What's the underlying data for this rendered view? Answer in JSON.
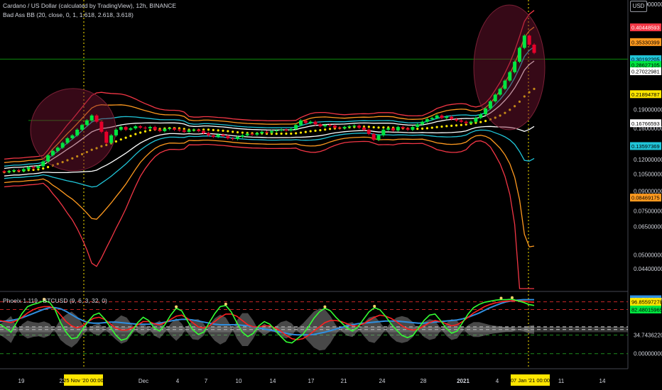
{
  "header": {
    "title": "Cardano / US Dollar (calculated by TradingView), 12h, BINANCE",
    "indicator1": "Bad Ass BB (20, close, 0, 1, 1.618, 2.618, 3.618)",
    "indicator2": "Phoeix 1.119 - BTCUSD (9, 6, 3, 32, 0)",
    "currency": "USD"
  },
  "colors": {
    "background": "#000000",
    "up_candle": "#00e640",
    "down_candle": "#e6002a",
    "green_line": "#0b8a0b",
    "band_red": "#f23645",
    "band_orange": "#ff9a1f",
    "band_cyan": "#20c5d8",
    "band_white": "#ffffff",
    "basis_yellow": "#ffe600",
    "osc_green": "#33ff33",
    "osc_red": "#ff2020",
    "osc_blue": "#2f8fe0"
  },
  "chart_data": [
    {
      "type": "candlestick",
      "title": "Cardano / US Dollar (calculated by TradingView), 12h, BINANCE",
      "scale": "log",
      "ylim": [
        0.036,
        0.52
      ],
      "x_ticks": [
        "19",
        "23",
        "Dec",
        "4",
        "7",
        "10",
        "14",
        "17",
        "21",
        "24",
        "28",
        "2021",
        "4",
        "11",
        "14"
      ],
      "x_highlights": [
        "25 Nov '20  00:00",
        "07 Jan '21  00:00"
      ],
      "y_ticks": [
        0.5,
        0.19,
        0.16,
        0.12,
        0.105,
        0.09,
        0.075,
        0.065,
        0.05,
        0.044
      ],
      "price_labels": [
        {
          "text": "0.40448593",
          "color": "#f23645"
        },
        {
          "text": "0.35330399",
          "color": "#ff9a1f"
        },
        {
          "text": "0.30254697",
          "color": "#e6002a"
        },
        {
          "text": "01:00:56",
          "color": "#e6002a"
        },
        {
          "text": "0.30192205",
          "color": "#20c5d8"
        },
        {
          "text": "0.28627105",
          "color": "#00e640"
        },
        {
          "text": "0.27022981",
          "color": "#ffffff"
        },
        {
          "text": "0.21894787",
          "color": "#ffe600"
        },
        {
          "text": "0.16766593",
          "color": "#ffffff"
        },
        {
          "text": "0.13597369",
          "color": "#20c5d8"
        },
        {
          "text": "0.08469175",
          "color": "#ff9a1f"
        }
      ],
      "series": [
        {
          "name": "close",
          "start": 0.108,
          "values": [
            0.107,
            0.108,
            0.109,
            0.108,
            0.11,
            0.112,
            0.111,
            0.113,
            0.118,
            0.125,
            0.13,
            0.134,
            0.14,
            0.146,
            0.15,
            0.158,
            0.165,
            0.172,
            0.18,
            0.17,
            0.155,
            0.14,
            0.15,
            0.158,
            0.162,
            0.158,
            0.16,
            0.163,
            0.161,
            0.16,
            0.162,
            0.158,
            0.156,
            0.159,
            0.16,
            0.158,
            0.157,
            0.155,
            0.157,
            0.158,
            0.156,
            0.153,
            0.15,
            0.148,
            0.151,
            0.149,
            0.146,
            0.145,
            0.148,
            0.15,
            0.152,
            0.151,
            0.153,
            0.155,
            0.154,
            0.156,
            0.157,
            0.158,
            0.157,
            0.159,
            0.165,
            0.172,
            0.168,
            0.17,
            0.166,
            0.163,
            0.165,
            0.164,
            0.161,
            0.16,
            0.162,
            0.163,
            0.164,
            0.161,
            0.158,
            0.152,
            0.144,
            0.15,
            0.158,
            0.16,
            0.157,
            0.162,
            0.16,
            0.158,
            0.162,
            0.166,
            0.17,
            0.174,
            0.176,
            0.18,
            0.176,
            0.178,
            0.174,
            0.172,
            0.17,
            0.168,
            0.17,
            0.176,
            0.182,
            0.192,
            0.205,
            0.218,
            0.23,
            0.248,
            0.268,
            0.295,
            0.335,
            0.375,
            0.345,
            0.32
          ]
        }
      ]
    },
    {
      "type": "line",
      "title": "Phoeix 1.119 - BTCUSD (9, 6, 3, 32, 0)",
      "ylim": [
        -15,
        115
      ],
      "y_ticks": [
        0.0,
        34.74362206,
        82.48015965,
        96.85597278,
        101.71204067
      ],
      "value_labels": [
        {
          "text": "101.71204067",
          "color": "#2f8fe0"
        },
        {
          "text": "96.85597278",
          "color": "#ffe600"
        },
        {
          "text": "82.48015965",
          "color": "#00e640"
        },
        {
          "text": "34.74362206",
          "color": "#000000"
        },
        {
          "text": "0.00000000",
          "color": "#000000"
        }
      ],
      "series": [
        {
          "name": "green",
          "values": [
            55,
            48,
            40,
            58,
            75,
            88,
            92,
            95,
            99,
            96,
            82,
            58,
            40,
            28,
            30,
            45,
            60,
            72,
            76,
            65,
            50,
            35,
            25,
            28,
            42,
            58,
            68,
            62,
            48,
            42,
            55,
            72,
            85,
            80,
            62,
            45,
            36,
            40,
            58,
            75,
            88,
            90,
            78,
            58,
            40,
            32,
            38,
            52,
            60,
            55,
            44,
            32,
            22,
            20,
            28,
            36,
            50,
            66,
            78,
            85,
            80,
            68,
            58,
            48,
            42,
            50,
            64,
            78,
            86,
            82,
            70,
            56,
            44,
            34,
            30,
            34,
            48,
            62,
            72,
            74,
            62,
            48,
            38,
            42,
            58,
            74,
            86,
            92,
            96,
            98,
            100,
            101,
            101,
            102,
            99,
            96,
            92,
            90
          ]
        },
        {
          "name": "red",
          "values": [
            62,
            60,
            58,
            62,
            68,
            76,
            82,
            86,
            88,
            88,
            84,
            72,
            60,
            52,
            48,
            52,
            60,
            66,
            68,
            64,
            56,
            48,
            44,
            44,
            48,
            54,
            60,
            60,
            56,
            54,
            58,
            64,
            70,
            72,
            66,
            58,
            50,
            48,
            52,
            60,
            68,
            74,
            74,
            70,
            62,
            54,
            50,
            50,
            52,
            52,
            48,
            42,
            34,
            28,
            26,
            28,
            34,
            42,
            50,
            58,
            62,
            62,
            60,
            56,
            52,
            52,
            56,
            62,
            68,
            72,
            70,
            66,
            60,
            52,
            46,
            44,
            46,
            52,
            58,
            62,
            60,
            56,
            52,
            54,
            60,
            68,
            76,
            82,
            88,
            92,
            95,
            97,
            98,
            99,
            99,
            98,
            97,
            96
          ]
        },
        {
          "name": "blue",
          "values": [
            60,
            61,
            62,
            64,
            67,
            71,
            75,
            79,
            83,
            86,
            86,
            84,
            79,
            73,
            67,
            62,
            58,
            57,
            57,
            58,
            59,
            59,
            58,
            57,
            56,
            55,
            55,
            55,
            56,
            57,
            59,
            61,
            63,
            64,
            64,
            63,
            61,
            59,
            57,
            55,
            54,
            54,
            54,
            54,
            53,
            52,
            50,
            48,
            46,
            44,
            42,
            40,
            38,
            36,
            35,
            35,
            35,
            36,
            38,
            40,
            43,
            46,
            49,
            52,
            54,
            56,
            57,
            58,
            59,
            60,
            61,
            61,
            61,
            60,
            59,
            58,
            57,
            57,
            58,
            59,
            60,
            61,
            62,
            63,
            65,
            68,
            72,
            76,
            81,
            86,
            90,
            94,
            97,
            99,
            100,
            101,
            101,
            101
          ]
        }
      ]
    }
  ]
}
